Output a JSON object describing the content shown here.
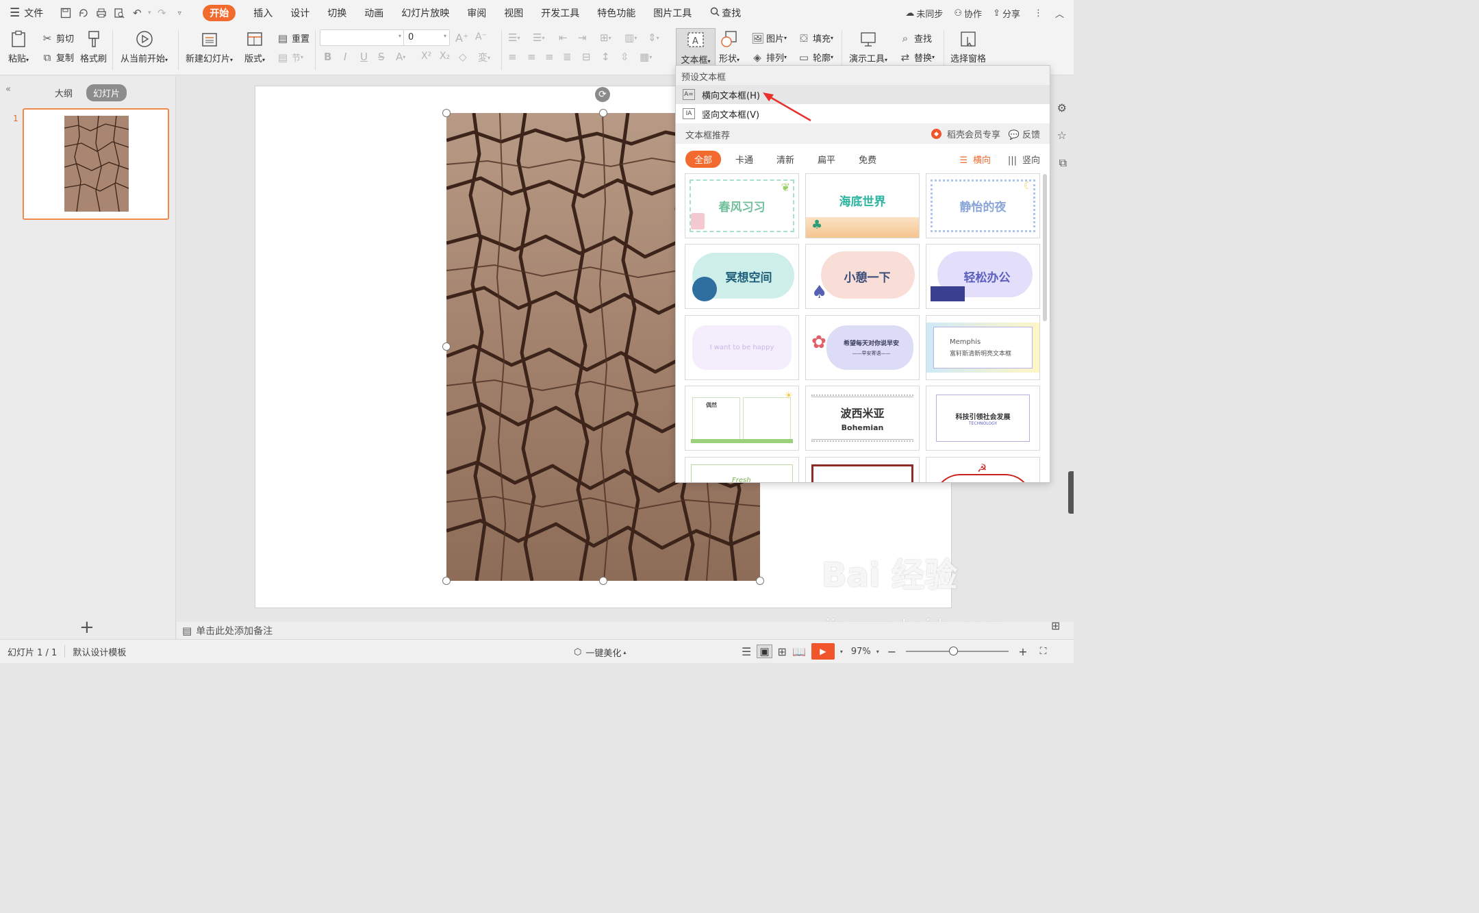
{
  "menubar": {
    "file": "文件",
    "tabs": [
      "开始",
      "插入",
      "设计",
      "切换",
      "动画",
      "幻灯片放映",
      "审阅",
      "视图",
      "开发工具",
      "特色功能",
      "图片工具"
    ],
    "search": "查找",
    "right": {
      "sync": "未同步",
      "collab": "协作",
      "share": "分享"
    }
  },
  "ribbon": {
    "paste": "粘贴",
    "cut": "剪切",
    "copy": "复制",
    "format_painter": "格式刷",
    "from_current": "从当前开始",
    "new_slide": "新建幻灯片",
    "layout": "版式",
    "reset": "重置",
    "section": "节",
    "font_size": "0",
    "textbox": "文本框",
    "shape": "形状",
    "picture": "图片",
    "fill": "填充",
    "arrange": "排列",
    "outline": "轮廓",
    "presenter_tools": "演示工具",
    "find": "查找",
    "replace": "替换",
    "selection_pane": "选择窗格"
  },
  "left_panel": {
    "tab_outline": "大纲",
    "tab_slides": "幻灯片",
    "slide_number": "1"
  },
  "notes": {
    "placeholder": "单击此处添加备注"
  },
  "statusbar": {
    "slide_info": "幻灯片 1 / 1",
    "template": "默认设计模板",
    "beautify": "一键美化",
    "zoom": "97%"
  },
  "dropdown": {
    "preset_title": "预设文本框",
    "horizontal": "横向文本框(H)",
    "vertical": "竖向文本框(V)",
    "recommend_title": "文本框推荐",
    "member": "稻壳会员专享",
    "feedback": "反馈",
    "categories": [
      "全部",
      "卡通",
      "清新",
      "扁平",
      "免费"
    ],
    "orient_h": "横向",
    "orient_v": "竖向",
    "cards": [
      {
        "title": "春风习习",
        "color": "#6fbf9a"
      },
      {
        "title": "海底世界",
        "color": "#2bb5a0"
      },
      {
        "title": "静怡的夜",
        "color": "#8aa5d8"
      },
      {
        "title": "冥想空间",
        "color": "#1f5f7a"
      },
      {
        "title": "小憩一下",
        "color": "#3b4e7a"
      },
      {
        "title": "轻松办公",
        "color": "#5a5fbf"
      },
      {
        "title": "I want to be happy",
        "color": "#c9b6e6"
      },
      {
        "title": "希望每天对你说早安",
        "subtitle": "——早安寄语——",
        "color": "#3a3a5a"
      },
      {
        "title": "Memphis",
        "subtitle": "富轩斯清新明亮文本框",
        "color": "#555"
      },
      {
        "title": "偶然",
        "color": "#555"
      },
      {
        "title": "波西米亚",
        "subtitle": "Bohemian",
        "color": "#333"
      },
      {
        "title": "科技引领社会发展",
        "subtitle": "TECHNOLOGY",
        "color": "#333"
      },
      {
        "title": "Fresh",
        "color": "#7ab04f"
      }
    ]
  },
  "watermark": {
    "line1": "Bai 经验",
    "line2": "jingyan.baidu.com"
  }
}
